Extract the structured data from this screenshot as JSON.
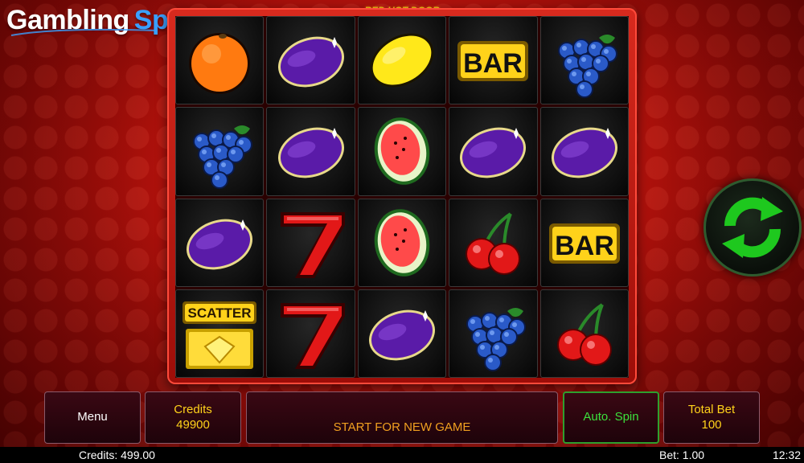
{
  "brand": {
    "word1": "Gambling",
    "word2": "Space"
  },
  "game": {
    "title": "RED HOT DOOR"
  },
  "reels": [
    [
      "orange",
      "plum",
      "lemon",
      "bar",
      "grapes"
    ],
    [
      "grapes",
      "plum",
      "watermelon",
      "plum",
      "plum"
    ],
    [
      "plum",
      "seven",
      "watermelon",
      "cherry",
      "bar"
    ],
    [
      "scatter",
      "seven",
      "plum",
      "grapes",
      "cherry"
    ]
  ],
  "symbol_text": {
    "bar": "BAR",
    "scatter": "SCATTER"
  },
  "controls": {
    "menu": "Menu",
    "credits_label": "Credits",
    "credits_value": "49900",
    "message": "START FOR NEW GAME",
    "auto_spin": "Auto. Spin",
    "total_bet_label": "Total Bet",
    "total_bet_value": "100",
    "spin_icon": "refresh-arrows-icon"
  },
  "status": {
    "credits": "Credits: 499.00",
    "bet": "Bet: 1.00",
    "clock": "12:32"
  },
  "colors": {
    "accent_green": "#2ecc2e",
    "gold": "#ffd21a",
    "brand_blue": "#3aa0ff",
    "background_red": "#c8160e"
  }
}
